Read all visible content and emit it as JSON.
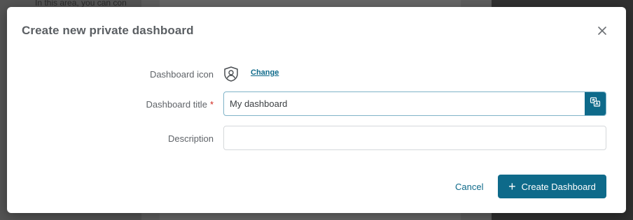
{
  "background": {
    "snippet_text": "In this area, you can con"
  },
  "dialog": {
    "title": "Create new private dashboard",
    "close_icon": "close-icon",
    "fields": {
      "icon": {
        "label": "Dashboard icon",
        "icon_name": "user-shield-icon",
        "change_link": "Change"
      },
      "title": {
        "label": "Dashboard title",
        "required_marker": "*",
        "value": "My dashboard",
        "translate_icon": "translate-icon"
      },
      "description": {
        "label": "Description",
        "value": ""
      }
    },
    "actions": {
      "cancel_label": "Cancel",
      "create_label": "Create Dashboard",
      "create_icon": "plus-icon"
    }
  },
  "colors": {
    "accent": "#0e6a8a",
    "required": "#d0251b",
    "title_text": "#5b5f63"
  }
}
